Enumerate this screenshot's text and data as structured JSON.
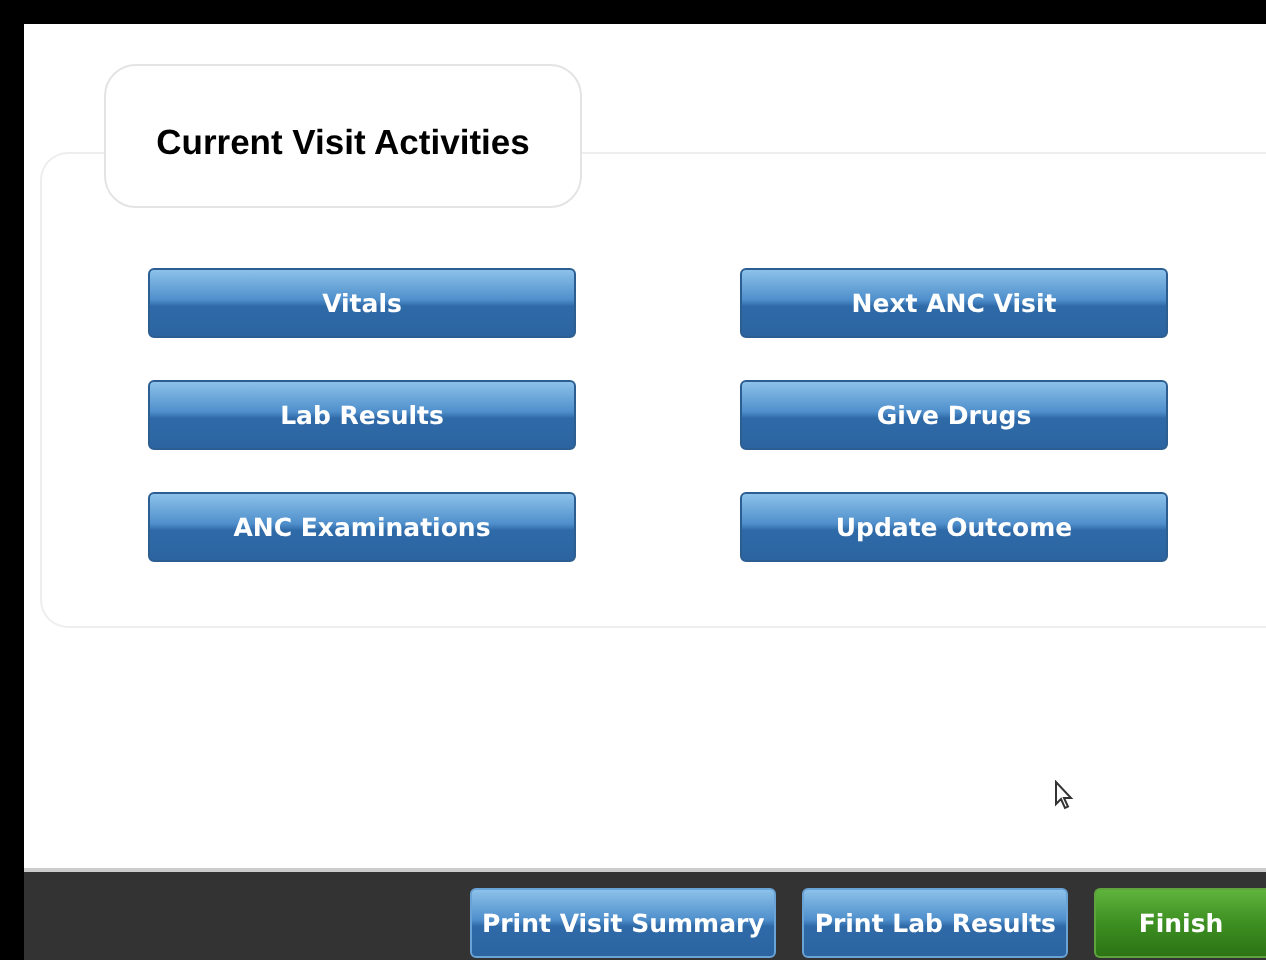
{
  "section": {
    "title": "Current Visit Activities",
    "activities": [
      {
        "label": "Vitals"
      },
      {
        "label": "Next ANC Visit"
      },
      {
        "label": "Lab Results"
      },
      {
        "label": "Give Drugs"
      },
      {
        "label": "ANC Examinations"
      },
      {
        "label": "Update Outcome"
      }
    ]
  },
  "footer": {
    "buttons": [
      {
        "label": "Print Visit Summary",
        "kind": "blue"
      },
      {
        "label": "Print Lab Results",
        "kind": "blue"
      },
      {
        "label": "Finish",
        "kind": "green"
      }
    ]
  }
}
